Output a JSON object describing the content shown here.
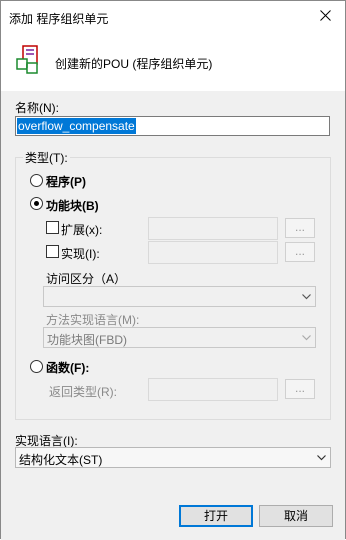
{
  "window": {
    "title": "添加 程序组织单元"
  },
  "header": {
    "text": "创建新的POU (程序组织单元)"
  },
  "name": {
    "label": "名称(N):",
    "value": "overflow_compensate"
  },
  "type_group": {
    "title": "类型(T):",
    "program_label": "程序(P)",
    "function_block_label": "功能块(B)",
    "extends_label": "扩展(x):",
    "implements_label": "实现(I):",
    "access_label": "访问区分（A）",
    "method_lang_label": "方法实现语言(M):",
    "method_lang_value": "功能块图(FBD)",
    "function_label": "函数(F):",
    "return_type_label": "返回类型(R):",
    "browse_label": "..."
  },
  "impl_language": {
    "label": "实现语言(I):",
    "value": "结构化文本(ST)"
  },
  "footer": {
    "open_label": "打开",
    "cancel_label": "取消"
  }
}
